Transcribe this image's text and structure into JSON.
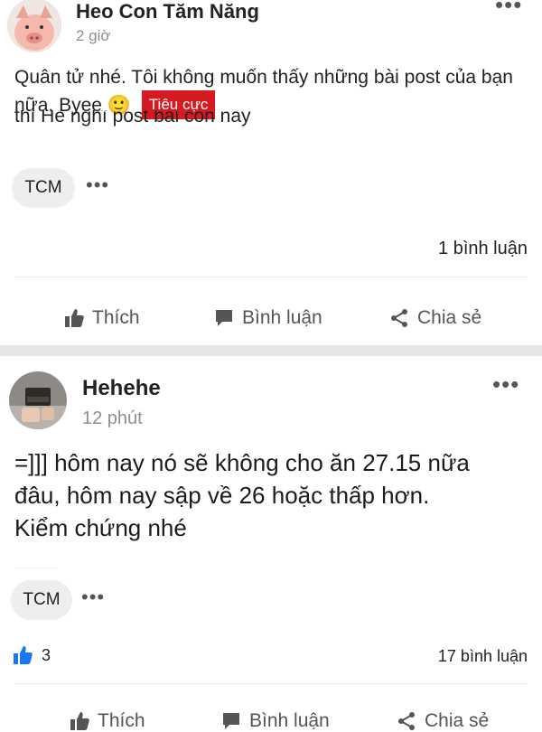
{
  "post1": {
    "author": "Heo Con Tăm Năng",
    "time": "2 giờ",
    "text": "Quân tử nhé. Tôi không muốn thấy những bài post của bạn nữa. Byee",
    "emoji": "🙂",
    "sentiment_badge": "Tiêu cực",
    "clipped_text": "thì Hè nghĩ post bài con này",
    "tag": "TCM",
    "comments": "1 bình luận"
  },
  "post2": {
    "author": "Hehehe",
    "time": "12 phút",
    "text_line1": "=]]] hôm nay nó sẽ không cho ăn 27.15 nữa",
    "text_line2": "đâu, hôm nay sập về 26 hoặc thấp hơn.",
    "text_line3": "Kiểm chứng nhé",
    "tag": "TCM",
    "likes": "3",
    "comments": "17 bình luận"
  },
  "actions": {
    "like": "Thích",
    "comment": "Bình luận",
    "share": "Chia sẻ"
  },
  "colors": {
    "badge_red": "#d71921",
    "like_blue": "#1877f2",
    "divider": "#e6e6e6"
  }
}
